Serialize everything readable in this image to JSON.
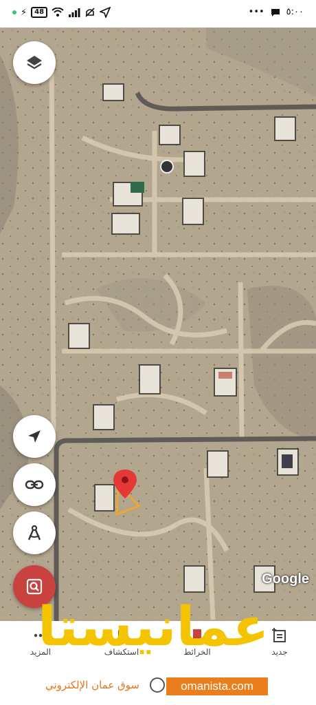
{
  "status_bar": {
    "battery": "48",
    "time": "٥:٠٠",
    "more": "•••"
  },
  "map": {
    "attribution": "Google",
    "icons": {
      "layers": "layers-icon",
      "location": "location-arrow-icon",
      "share": "link-icon",
      "measure": "compass-measure-icon",
      "search": "search-area-icon",
      "pin": "map-pin-icon"
    },
    "colors": {
      "pin": "#e53935",
      "search_fab": "#c9423f",
      "direction_cone": "#f0a630"
    }
  },
  "bottom_nav": {
    "items": [
      {
        "label": "جديد",
        "icon": "add-note-icon"
      },
      {
        "label": "الخرائط",
        "icon": "map-icon"
      },
      {
        "label": "استكشاف",
        "icon": "explore-icon"
      },
      {
        "label": "المزيد",
        "icon": "more-icon"
      }
    ]
  },
  "watermark": {
    "brand": "عمانيستا",
    "url": "omanista.com",
    "tagline": "سوق عمان الإلكتروني",
    "brand_color": "#f5c400",
    "accent_color": "#ea7e1d"
  }
}
